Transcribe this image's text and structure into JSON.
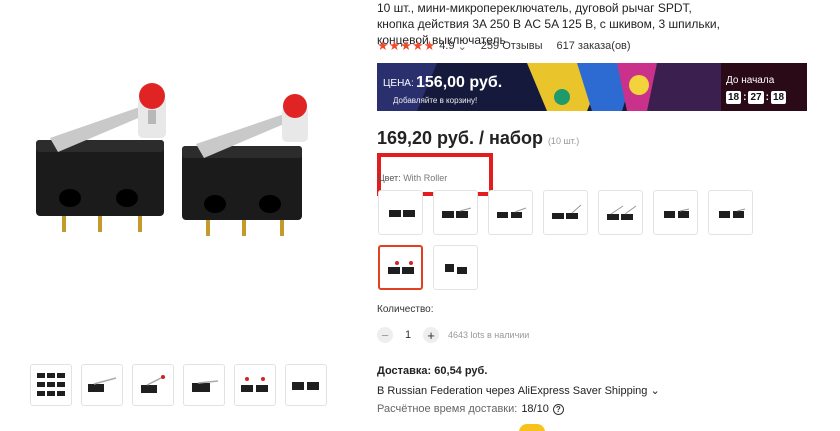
{
  "product": {
    "title": "10 шт., мини-микропереключатель, дуговой рычаг SPDT, кнопка действия 3A 250 В AC 5A 125 В, с шкивом, 3 шпильки, концевой выключатель",
    "rating": "4.9",
    "rating_chevron": "⌄",
    "reviews": "259 Отзывы",
    "orders": "617 заказа(ов)"
  },
  "promo": {
    "label": "ЦЕНА:",
    "price": "156,00 руб.",
    "subtitle": "Добавляйте в корзину!",
    "timer_label": "До начала",
    "hours": "18",
    "minutes": "27",
    "seconds": "18"
  },
  "price": {
    "main": "169,20 руб. / набор",
    "note": "(10 шт.)"
  },
  "variant": {
    "label": "Цвет:",
    "value": "With Roller",
    "options_count_visible": 9,
    "selected_option": "With Roller"
  },
  "quantity": {
    "label": "Количество:",
    "value": "1",
    "minus": "−",
    "plus": "+",
    "stock": "4643 lots в наличии"
  },
  "shipping": {
    "title": "Доставка: 60,54 руб.",
    "method": "В Russian Federation через AliExpress Saver Shipping ⌄",
    "eta_label": "Расчётное время доставки:",
    "eta_date": "18/10",
    "help": "?"
  },
  "colors": {
    "accent": "#e3401f",
    "star": "#f04a2d",
    "highlight": "#e11d1d"
  }
}
